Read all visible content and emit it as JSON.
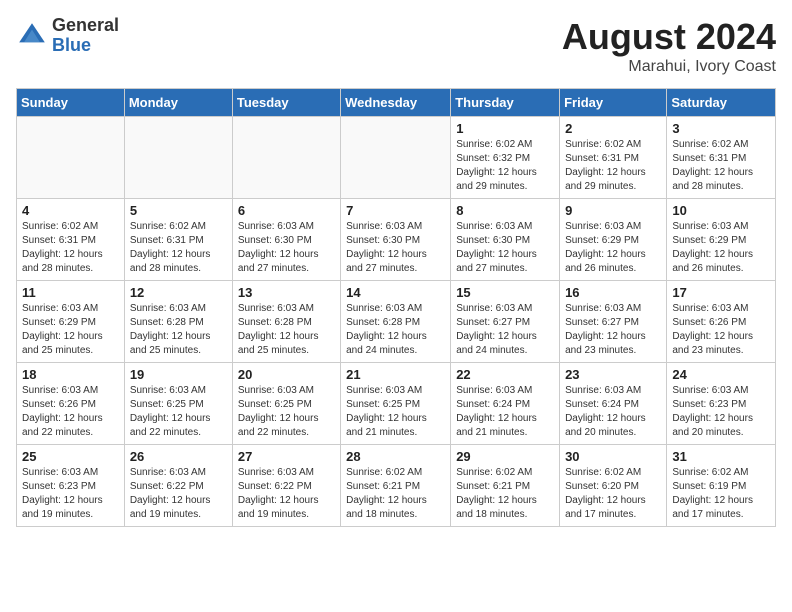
{
  "logo": {
    "general": "General",
    "blue": "Blue"
  },
  "header": {
    "title": "August 2024",
    "subtitle": "Marahui, Ivory Coast"
  },
  "weekdays": [
    "Sunday",
    "Monday",
    "Tuesday",
    "Wednesday",
    "Thursday",
    "Friday",
    "Saturday"
  ],
  "weeks": [
    [
      {
        "day": "",
        "info": ""
      },
      {
        "day": "",
        "info": ""
      },
      {
        "day": "",
        "info": ""
      },
      {
        "day": "",
        "info": ""
      },
      {
        "day": "1",
        "info": "Sunrise: 6:02 AM\nSunset: 6:32 PM\nDaylight: 12 hours\nand 29 minutes."
      },
      {
        "day": "2",
        "info": "Sunrise: 6:02 AM\nSunset: 6:31 PM\nDaylight: 12 hours\nand 29 minutes."
      },
      {
        "day": "3",
        "info": "Sunrise: 6:02 AM\nSunset: 6:31 PM\nDaylight: 12 hours\nand 28 minutes."
      }
    ],
    [
      {
        "day": "4",
        "info": "Sunrise: 6:02 AM\nSunset: 6:31 PM\nDaylight: 12 hours\nand 28 minutes."
      },
      {
        "day": "5",
        "info": "Sunrise: 6:02 AM\nSunset: 6:31 PM\nDaylight: 12 hours\nand 28 minutes."
      },
      {
        "day": "6",
        "info": "Sunrise: 6:03 AM\nSunset: 6:30 PM\nDaylight: 12 hours\nand 27 minutes."
      },
      {
        "day": "7",
        "info": "Sunrise: 6:03 AM\nSunset: 6:30 PM\nDaylight: 12 hours\nand 27 minutes."
      },
      {
        "day": "8",
        "info": "Sunrise: 6:03 AM\nSunset: 6:30 PM\nDaylight: 12 hours\nand 27 minutes."
      },
      {
        "day": "9",
        "info": "Sunrise: 6:03 AM\nSunset: 6:29 PM\nDaylight: 12 hours\nand 26 minutes."
      },
      {
        "day": "10",
        "info": "Sunrise: 6:03 AM\nSunset: 6:29 PM\nDaylight: 12 hours\nand 26 minutes."
      }
    ],
    [
      {
        "day": "11",
        "info": "Sunrise: 6:03 AM\nSunset: 6:29 PM\nDaylight: 12 hours\nand 25 minutes."
      },
      {
        "day": "12",
        "info": "Sunrise: 6:03 AM\nSunset: 6:28 PM\nDaylight: 12 hours\nand 25 minutes."
      },
      {
        "day": "13",
        "info": "Sunrise: 6:03 AM\nSunset: 6:28 PM\nDaylight: 12 hours\nand 25 minutes."
      },
      {
        "day": "14",
        "info": "Sunrise: 6:03 AM\nSunset: 6:28 PM\nDaylight: 12 hours\nand 24 minutes."
      },
      {
        "day": "15",
        "info": "Sunrise: 6:03 AM\nSunset: 6:27 PM\nDaylight: 12 hours\nand 24 minutes."
      },
      {
        "day": "16",
        "info": "Sunrise: 6:03 AM\nSunset: 6:27 PM\nDaylight: 12 hours\nand 23 minutes."
      },
      {
        "day": "17",
        "info": "Sunrise: 6:03 AM\nSunset: 6:26 PM\nDaylight: 12 hours\nand 23 minutes."
      }
    ],
    [
      {
        "day": "18",
        "info": "Sunrise: 6:03 AM\nSunset: 6:26 PM\nDaylight: 12 hours\nand 22 minutes."
      },
      {
        "day": "19",
        "info": "Sunrise: 6:03 AM\nSunset: 6:25 PM\nDaylight: 12 hours\nand 22 minutes."
      },
      {
        "day": "20",
        "info": "Sunrise: 6:03 AM\nSunset: 6:25 PM\nDaylight: 12 hours\nand 22 minutes."
      },
      {
        "day": "21",
        "info": "Sunrise: 6:03 AM\nSunset: 6:25 PM\nDaylight: 12 hours\nand 21 minutes."
      },
      {
        "day": "22",
        "info": "Sunrise: 6:03 AM\nSunset: 6:24 PM\nDaylight: 12 hours\nand 21 minutes."
      },
      {
        "day": "23",
        "info": "Sunrise: 6:03 AM\nSunset: 6:24 PM\nDaylight: 12 hours\nand 20 minutes."
      },
      {
        "day": "24",
        "info": "Sunrise: 6:03 AM\nSunset: 6:23 PM\nDaylight: 12 hours\nand 20 minutes."
      }
    ],
    [
      {
        "day": "25",
        "info": "Sunrise: 6:03 AM\nSunset: 6:23 PM\nDaylight: 12 hours\nand 19 minutes."
      },
      {
        "day": "26",
        "info": "Sunrise: 6:03 AM\nSunset: 6:22 PM\nDaylight: 12 hours\nand 19 minutes."
      },
      {
        "day": "27",
        "info": "Sunrise: 6:03 AM\nSunset: 6:22 PM\nDaylight: 12 hours\nand 19 minutes."
      },
      {
        "day": "28",
        "info": "Sunrise: 6:02 AM\nSunset: 6:21 PM\nDaylight: 12 hours\nand 18 minutes."
      },
      {
        "day": "29",
        "info": "Sunrise: 6:02 AM\nSunset: 6:21 PM\nDaylight: 12 hours\nand 18 minutes."
      },
      {
        "day": "30",
        "info": "Sunrise: 6:02 AM\nSunset: 6:20 PM\nDaylight: 12 hours\nand 17 minutes."
      },
      {
        "day": "31",
        "info": "Sunrise: 6:02 AM\nSunset: 6:19 PM\nDaylight: 12 hours\nand 17 minutes."
      }
    ]
  ]
}
